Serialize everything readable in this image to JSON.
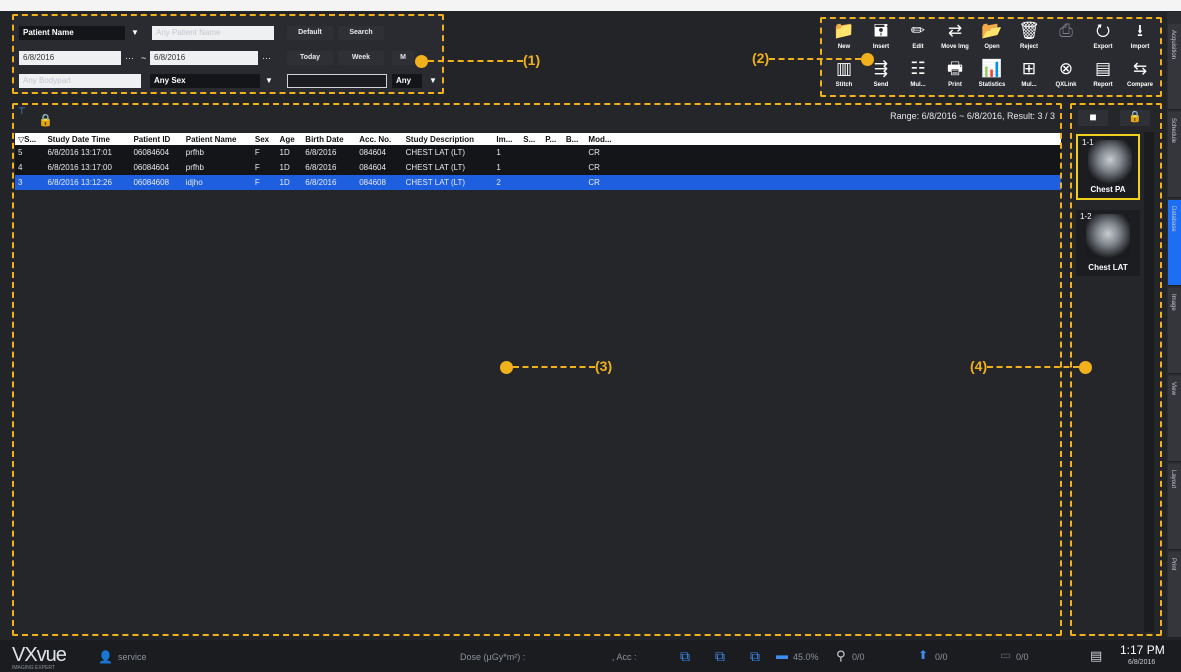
{
  "search": {
    "field_type": "Patient Name",
    "patient_name_placeholder": "Any Patient Name",
    "date_from": "6/8/2016",
    "date_to": "6/8/2016",
    "date_sep": "~",
    "dots": "···",
    "bodypart_placeholder": "Any Bodypart",
    "sex": "Any Sex",
    "any_value": "Any",
    "buttons": {
      "default": "Default",
      "search": "Search",
      "today": "Today",
      "week": "Week",
      "more": "M"
    }
  },
  "toolbar": {
    "row1": [
      {
        "label": "New",
        "icon": "📁"
      },
      {
        "label": "Insert",
        "icon": "🖬"
      },
      {
        "label": "Edit",
        "icon": "✏"
      },
      {
        "label": "Move Img",
        "icon": "⇄"
      },
      {
        "label": "Open",
        "icon": "📂"
      },
      {
        "label": "Reject",
        "icon": "🗑"
      },
      {
        "label": "",
        "icon": "⎙"
      },
      {
        "label": "Export",
        "icon": "⭮"
      },
      {
        "label": "Import",
        "icon": "⭳"
      }
    ],
    "row2": [
      {
        "label": "Stitch",
        "icon": "▥"
      },
      {
        "label": "Send",
        "icon": "⇶"
      },
      {
        "label": "Mul...",
        "icon": "☷"
      },
      {
        "label": "Print",
        "icon": "🖶"
      },
      {
        "label": "Statistics",
        "icon": "📊"
      },
      {
        "label": "Mul...",
        "icon": "⊞"
      },
      {
        "label": "QXLink",
        "icon": "⊗"
      },
      {
        "label": "Report",
        "icon": "▤"
      },
      {
        "label": "Compare",
        "icon": "⇆"
      }
    ]
  },
  "callouts": {
    "one": "(1)",
    "two": "(2)",
    "three": "(3)",
    "four": "(4)"
  },
  "study_list": {
    "range_text": "Range: 6/8/2016 ~ 6/8/2016, Result: 3 / 3",
    "columns": [
      "▽S...",
      "Study Date Time",
      "Patient ID",
      "Patient Name",
      "Sex",
      "Age",
      "Birth Date",
      "Acc. No.",
      "Study Description",
      "Im...",
      "S...",
      "P...",
      "B...",
      "Mod..."
    ],
    "rows": [
      {
        "s": "5",
        "date": "6/8/2016 13:17:01",
        "pid": "06084604",
        "name": "prfhb",
        "sex": "F",
        "age": "1D",
        "birth": "6/8/2016",
        "acc": "084604",
        "desc": "CHEST LAT (LT)",
        "im": "1",
        "mod": "CR"
      },
      {
        "s": "4",
        "date": "6/8/2016 13:17:00",
        "pid": "06084604",
        "name": "prfhb",
        "sex": "F",
        "age": "1D",
        "birth": "6/8/2016",
        "acc": "084604",
        "desc": "CHEST LAT (LT)",
        "im": "1",
        "mod": "CR"
      },
      {
        "s": "3",
        "date": "6/8/2016 13:12:26",
        "pid": "06084608",
        "name": "idjho",
        "sex": "F",
        "age": "1D",
        "birth": "6/8/2016",
        "acc": "084608",
        "desc": "CHEST LAT (LT)",
        "im": "2",
        "mod": "CR"
      }
    ]
  },
  "thumbnails": [
    {
      "num": "1-1",
      "caption": "Chest PA"
    },
    {
      "num": "1-2",
      "caption": "Chest LAT"
    }
  ],
  "right_tabs": [
    "Acquisition",
    "Schedule",
    "Database",
    "Image",
    "View",
    "Layout",
    "Print"
  ],
  "statusbar": {
    "brand": "VXvue",
    "brand_sub": "IMAGING EXPERT",
    "user": "service",
    "dose": "Dose (µGy*m²) :",
    "acc": ", Acc :",
    "disk": "45.0%",
    "usb": "0/0",
    "upload": "0/0",
    "print": "0/0",
    "time": "1:17 PM",
    "date": "6/8/2016"
  },
  "colors": {
    "accent": "#f0b11d",
    "selected_row": "#1e5fe0",
    "active_tab": "#1c6ef2"
  }
}
